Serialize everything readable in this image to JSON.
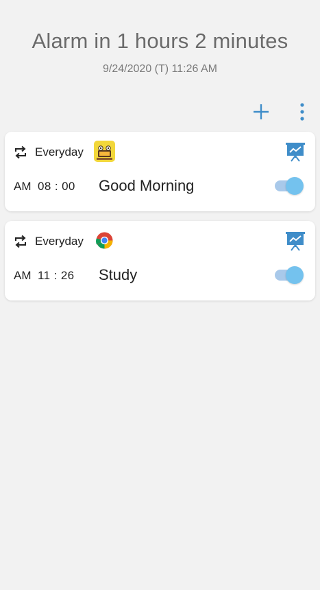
{
  "header": {
    "title": "Alarm in 1 hours 2 minutes",
    "subtitle": "9/24/2020 (T) 11:26 AM"
  },
  "toolbar": {
    "add_icon": "plus-icon",
    "more_icon": "more-vertical-icon"
  },
  "colors": {
    "accent": "#3f8dc9",
    "toggle_track": "#a9c9ea",
    "toggle_thumb": "#74c2ee",
    "background": "#f2f2f2"
  },
  "alarms": [
    {
      "repeat_icon": "repeat-icon",
      "repeat": "Everyday",
      "app_icon": "game-app-icon",
      "stats_icon": "chart-board-icon",
      "ampm": "AM",
      "time": "08 : 00",
      "name": "Good Morning",
      "enabled": true
    },
    {
      "repeat_icon": "repeat-icon",
      "repeat": "Everyday",
      "app_icon": "chrome-icon",
      "stats_icon": "chart-board-icon",
      "ampm": "AM",
      "time": "11 : 26",
      "name": "Study",
      "enabled": true
    }
  ]
}
